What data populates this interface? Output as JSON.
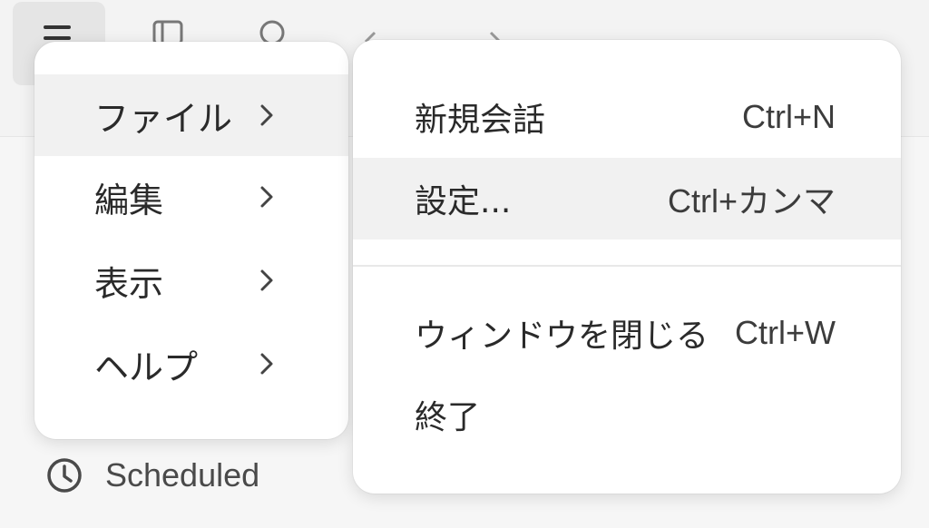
{
  "main_menu": {
    "items": [
      {
        "label": "ファイル",
        "highlighted": true
      },
      {
        "label": "編集",
        "highlighted": false
      },
      {
        "label": "表示",
        "highlighted": false
      },
      {
        "label": "ヘルプ",
        "highlighted": false
      }
    ]
  },
  "submenu": {
    "items": [
      {
        "label": "新規会話",
        "shortcut": "Ctrl+N"
      },
      {
        "label": "設定...",
        "shortcut": "Ctrl+カンマ"
      },
      {
        "label": "ウィンドウを閉じる",
        "shortcut": "Ctrl+W"
      },
      {
        "label": "終了",
        "shortcut": ""
      }
    ]
  },
  "sidebar": {
    "scheduled_label": "Scheduled"
  },
  "colors": {
    "menu_bg": "#ffffff",
    "highlight_bg": "#f1f1f1",
    "app_bg": "#f3f3f3"
  },
  "icons": [
    "hamburger-menu-icon",
    "sidebar-toggle-icon",
    "search-icon",
    "back-arrow-icon",
    "forward-arrow-icon",
    "chevron-right-icon",
    "clock-icon"
  ]
}
